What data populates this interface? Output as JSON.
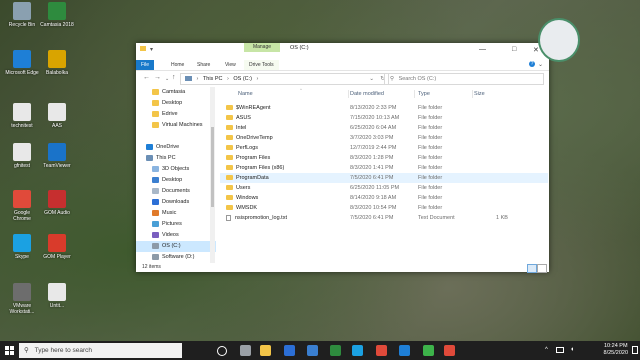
{
  "desktop": {
    "icons": [
      {
        "label": "Recycle Bin",
        "color": "#8aa0b0"
      },
      {
        "label": "Camtasia 2018",
        "color": "#2e8b3e"
      },
      {
        "label": "Microsoft Edge",
        "color": "#1e7fd6"
      },
      {
        "label": "Balabolka",
        "color": "#d9a400"
      },
      {
        "label": "technitest",
        "color": "#e8e8e8"
      },
      {
        "label": "AAS",
        "color": "#e8e8e8"
      },
      {
        "label": "gfnitest",
        "color": "#e8e8e8"
      },
      {
        "label": "TeamViewer",
        "color": "#1a73c9"
      },
      {
        "label": "Google Chrome",
        "color": "#e04a3a"
      },
      {
        "label": "GOM Audio",
        "color": "#c62f2f"
      },
      {
        "label": "Skype",
        "color": "#1ba1e2"
      },
      {
        "label": "GOM Player",
        "color": "#d93b2b"
      },
      {
        "label": "VMware Workstati...",
        "color": "#6d6d6d"
      },
      {
        "label": "Untit...",
        "color": "#e8e8e8"
      }
    ]
  },
  "window": {
    "manage_tab": "Manage",
    "title": "OS (C:)",
    "controls": {
      "minimize": "—",
      "maximize": "□",
      "close": "✕"
    },
    "ribbon_tabs": [
      "File",
      "Home",
      "Share",
      "View",
      "Drive Tools"
    ],
    "address": {
      "parts": [
        "This PC",
        "OS (C:)"
      ]
    },
    "search_placeholder": "Search OS (C:)",
    "nav": [
      {
        "label": "Camtasia",
        "type": "folder",
        "indent": 16
      },
      {
        "label": "Desktop",
        "type": "folder",
        "indent": 16
      },
      {
        "label": "Edrive",
        "type": "folder",
        "indent": 16
      },
      {
        "label": "Virtual Machines",
        "type": "folder",
        "indent": 16
      },
      {
        "label": "",
        "type": "blank",
        "indent": 16
      },
      {
        "label": "OneDrive",
        "type": "cloud",
        "indent": 10
      },
      {
        "label": "This PC",
        "type": "pc",
        "indent": 10
      },
      {
        "label": "3D Objects",
        "type": "3d",
        "indent": 16
      },
      {
        "label": "Desktop",
        "type": "desk",
        "indent": 16
      },
      {
        "label": "Documents",
        "type": "doc",
        "indent": 16
      },
      {
        "label": "Downloads",
        "type": "down",
        "indent": 16
      },
      {
        "label": "Music",
        "type": "music",
        "indent": 16
      },
      {
        "label": "Pictures",
        "type": "pic",
        "indent": 16
      },
      {
        "label": "Videos",
        "type": "video",
        "indent": 16
      },
      {
        "label": "OS (C:)",
        "type": "drive",
        "indent": 16,
        "selected": true
      },
      {
        "label": "Software (D:)",
        "type": "drive",
        "indent": 16
      }
    ],
    "columns": {
      "name": "Name",
      "date": "Date modified",
      "type": "Type",
      "size": "Size"
    },
    "files": [
      {
        "name": "$WinREAgent",
        "date": "8/13/2020 2:33 PM",
        "type": "File folder",
        "size": "",
        "kind": "folder"
      },
      {
        "name": "ASUS",
        "date": "7/15/2020 10:13 AM",
        "type": "File folder",
        "size": "",
        "kind": "folder"
      },
      {
        "name": "Intel",
        "date": "6/25/2020 6:04 AM",
        "type": "File folder",
        "size": "",
        "kind": "folder"
      },
      {
        "name": "OneDriveTemp",
        "date": "3/7/2020 3:03 PM",
        "type": "File folder",
        "size": "",
        "kind": "folder"
      },
      {
        "name": "PerfLogs",
        "date": "12/7/2019 2:44 PM",
        "type": "File folder",
        "size": "",
        "kind": "folder"
      },
      {
        "name": "Program Files",
        "date": "8/3/2020 1:28 PM",
        "type": "File folder",
        "size": "",
        "kind": "folder"
      },
      {
        "name": "Program Files (x86)",
        "date": "8/3/2020 1:41 PM",
        "type": "File folder",
        "size": "",
        "kind": "folder"
      },
      {
        "name": "ProgramData",
        "date": "7/5/2020 6:41 PM",
        "type": "File folder",
        "size": "",
        "kind": "folder",
        "highlight": true
      },
      {
        "name": "Users",
        "date": "6/25/2020 11:05 PM",
        "type": "File folder",
        "size": "",
        "kind": "folder"
      },
      {
        "name": "Windows",
        "date": "8/14/2020 9:18 AM",
        "type": "File folder",
        "size": "",
        "kind": "folder"
      },
      {
        "name": "WMSDK",
        "date": "8/3/2020 10:54 PM",
        "type": "File folder",
        "size": "",
        "kind": "folder"
      },
      {
        "name": "nsispromotion_log.txt",
        "date": "7/5/2020 6:41 PM",
        "type": "Text Document",
        "size": "1 KB",
        "kind": "txt"
      }
    ],
    "status": "12 items"
  },
  "taskbar": {
    "search_placeholder": "Type here to search",
    "icons": [
      {
        "name": "task-view-icon",
        "color": "#ffffff"
      },
      {
        "name": "settings-icon",
        "color": "#9aa0a6"
      },
      {
        "name": "file-explorer-icon",
        "color": "#f3c548"
      },
      {
        "name": "store-icon",
        "color": "#2c6fd6"
      },
      {
        "name": "photos-icon",
        "color": "#3a7fd0"
      },
      {
        "name": "camtasia-icon",
        "color": "#2e8b3e"
      },
      {
        "name": "skype-icon",
        "color": "#1ba1e2"
      },
      {
        "name": "chrome-icon",
        "color": "#e04a3a"
      },
      {
        "name": "edge-icon",
        "color": "#1e7fd6"
      },
      {
        "name": "camtasia-recorder-icon",
        "color": "#3db34a"
      },
      {
        "name": "media-icon",
        "color": "#e04a3a"
      }
    ],
    "time": "10:24 PM",
    "date": "8/25/2020"
  }
}
